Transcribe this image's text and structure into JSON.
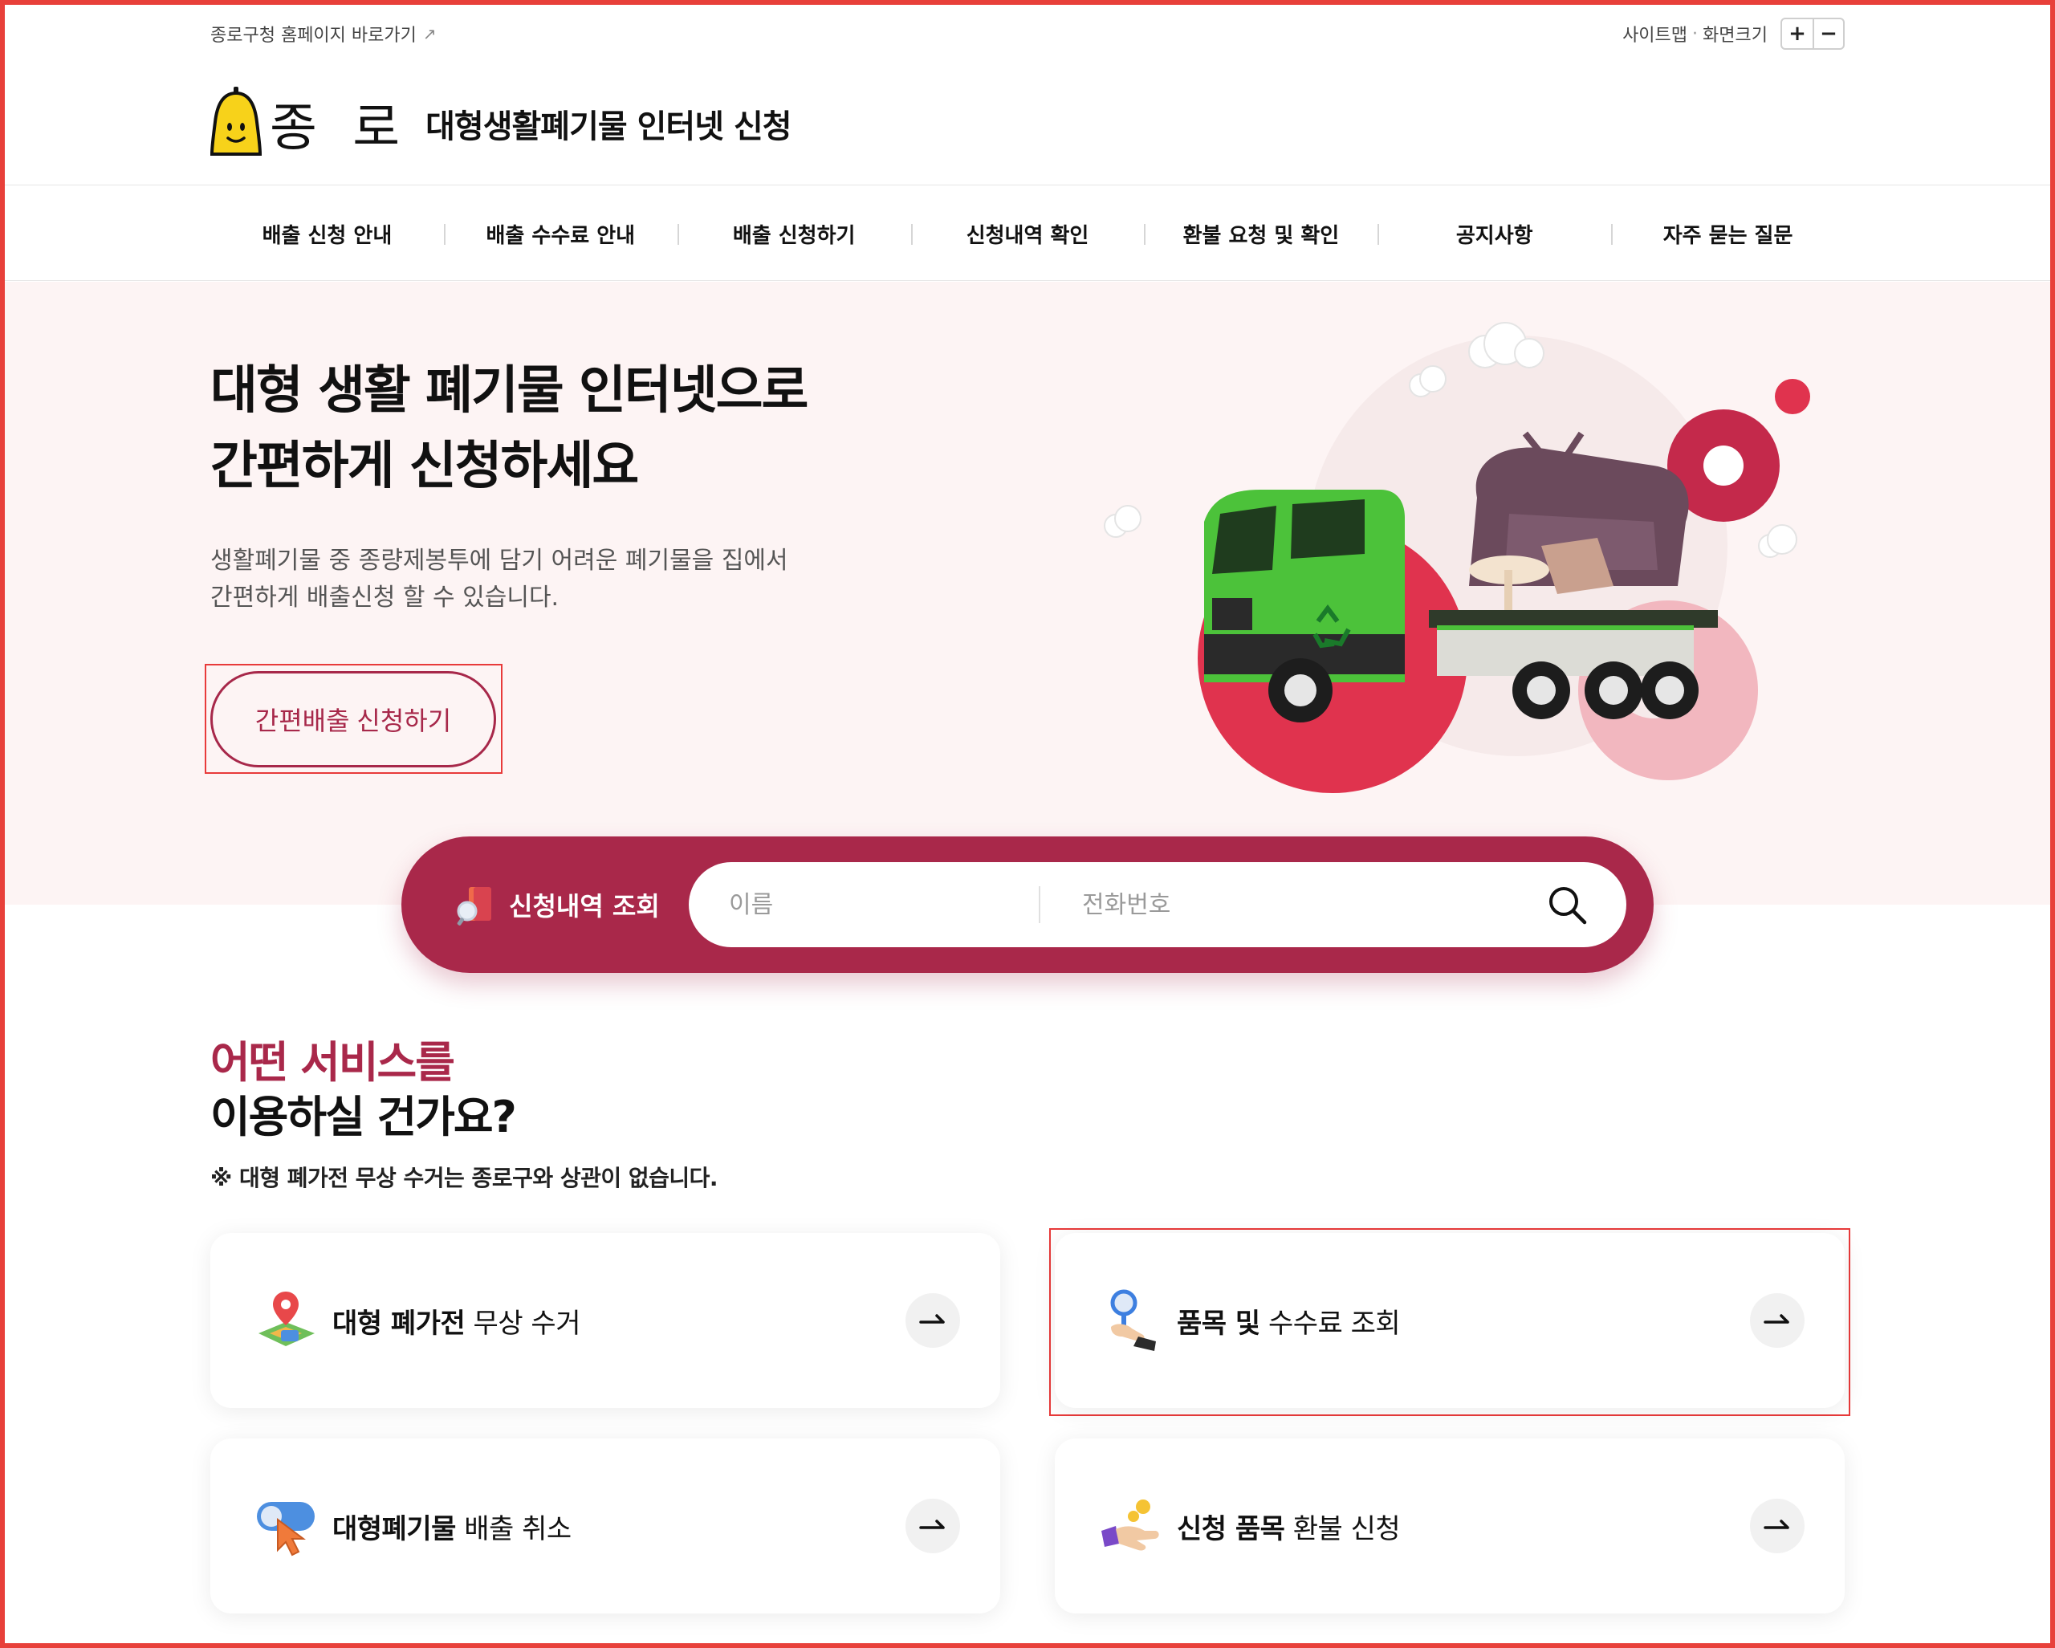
{
  "top": {
    "home_link": "종로구청 홈페이지 바로가기",
    "sitemap": "사이트맵",
    "separator": "·",
    "font_size_label": "화면크기",
    "zoom_in": "+",
    "zoom_out": "−"
  },
  "header": {
    "logo_text": "종 로",
    "site_title": "대형생활폐기물 인터넷 신청"
  },
  "nav": {
    "items": [
      {
        "label": "배출 신청 안내"
      },
      {
        "label": "배출 수수료 안내"
      },
      {
        "label": "배출 신청하기"
      },
      {
        "label": "신청내역 확인"
      },
      {
        "label": "환불 요청 및 확인"
      },
      {
        "label": "공지사항"
      },
      {
        "label": "자주 묻는 질문"
      }
    ]
  },
  "hero": {
    "title_line1": "대형 생활 폐기물 인터넷으로",
    "title_line2": "간편하게 신청하세요",
    "desc_line1": "생활폐기물 중 종량제봉투에 담기 어려운 폐기물을 집에서",
    "desc_line2": "간편하게 배출신청 할 수 있습니다.",
    "button_label": "간편배출 신청하기"
  },
  "search": {
    "label": "신청내역 조회",
    "name_placeholder": "이름",
    "phone_placeholder": "전화번호"
  },
  "services": {
    "title_accent": "어떤 서비스를",
    "title_dark": "이용하실 건가요?",
    "note": "※ 대형 폐가전 무상 수거는 종로구와 상관이 없습니다.",
    "cards": [
      {
        "bold": "대형 폐가전",
        "rest": " 무상 수거",
        "icon": "map-pin-icon"
      },
      {
        "bold": "품목 및",
        "rest": " 수수료 조회",
        "icon": "magnifier-hand-icon"
      },
      {
        "bold": "대형폐기물",
        "rest": " 배출 취소",
        "icon": "toggle-cursor-icon"
      },
      {
        "bold": "신청 품목",
        "rest": " 환불 신청",
        "icon": "coin-hand-icon"
      }
    ]
  },
  "colors": {
    "accent": "#a9284a",
    "hero_bg": "#fdf4f4",
    "truck_green": "#4cc23a"
  }
}
